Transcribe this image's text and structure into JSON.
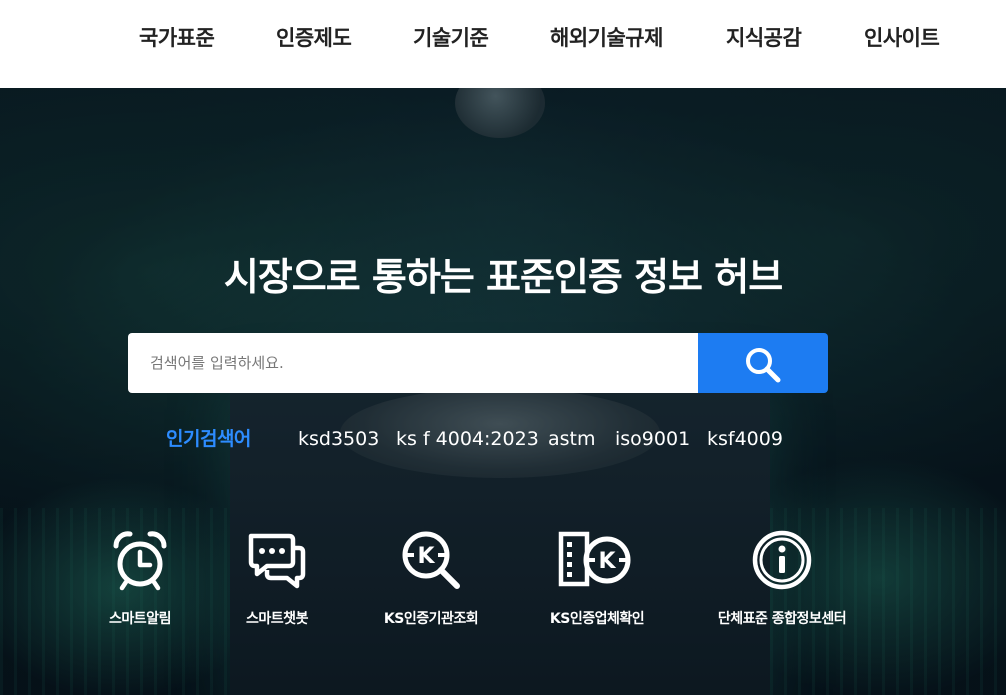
{
  "nav": {
    "items": [
      {
        "label": "국가표준"
      },
      {
        "label": "인증제도"
      },
      {
        "label": "기술기준"
      },
      {
        "label": "해외기술규제"
      },
      {
        "label": "지식공감"
      },
      {
        "label": "인사이트"
      }
    ]
  },
  "hero": {
    "headline": "시장으로 통하는 표준인증 정보 허브",
    "search": {
      "placeholder": "검색어를 입력하세요.",
      "value": "",
      "button_icon": "search-icon"
    },
    "popular": {
      "label": "인기검색어",
      "keywords": [
        "ksd3503",
        "ks f 4004:2023",
        "astm",
        "iso9001",
        "ksf4009"
      ]
    },
    "quick_links": [
      {
        "label": "스마트알림",
        "icon": "alarm-clock-icon"
      },
      {
        "label": "스마트챗봇",
        "icon": "chat-bubbles-icon"
      },
      {
        "label": "KS인증기관조회",
        "icon": "ks-search-icon"
      },
      {
        "label": "KS인증업체확인",
        "icon": "ks-building-icon"
      },
      {
        "label": "단체표준 종합정보센터",
        "icon": "info-circle-icon"
      }
    ]
  },
  "colors": {
    "accent": "#1d7cf2",
    "popular_label": "#2d8cff",
    "nav_text": "#222222"
  }
}
